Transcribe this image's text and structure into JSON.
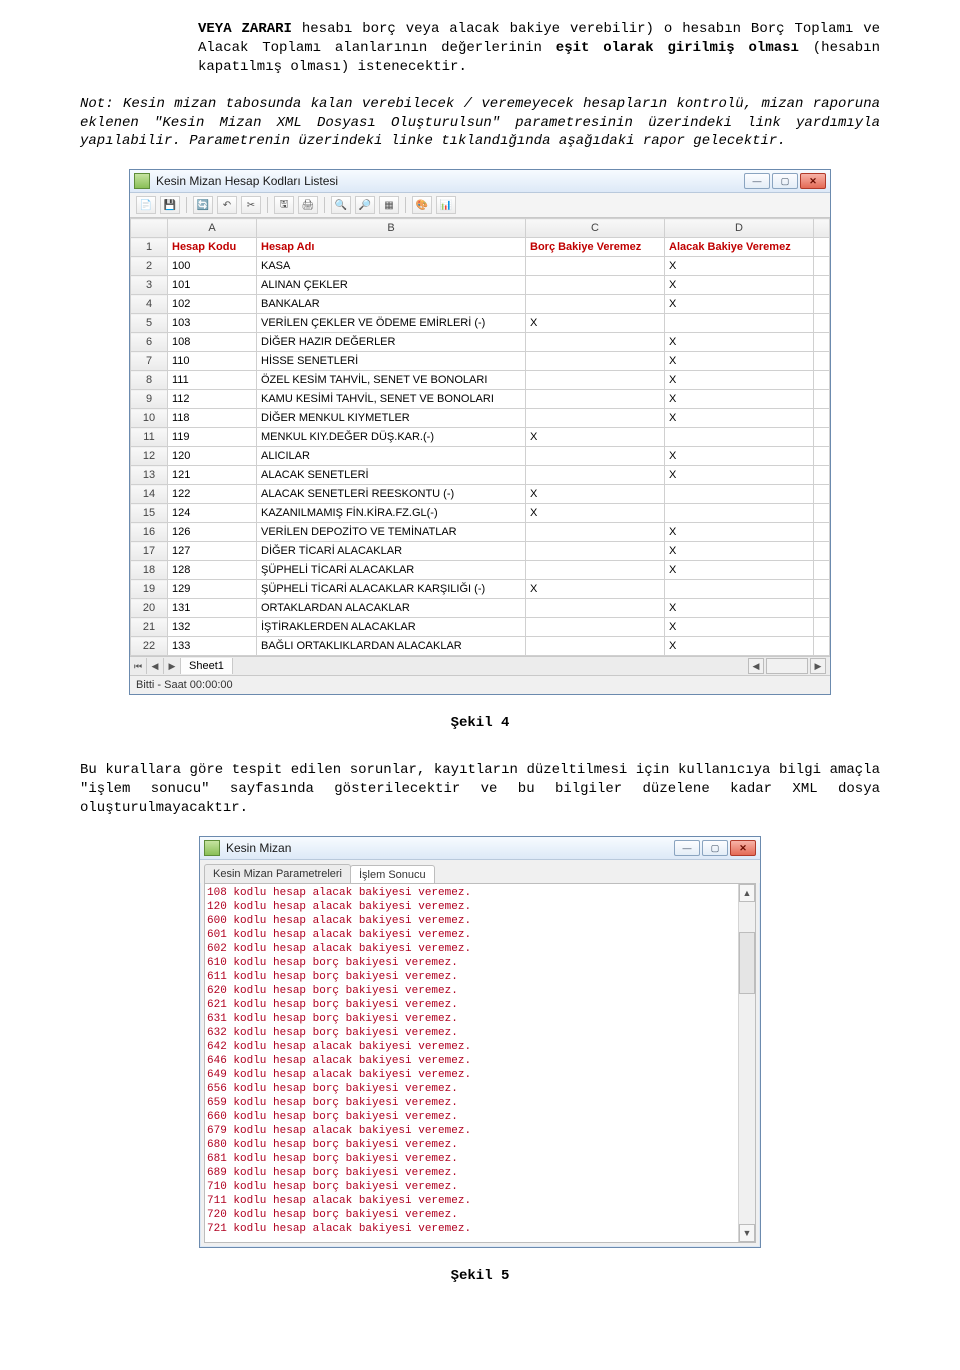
{
  "paragraphs": {
    "p1_prefix": "VEYA ZARARI",
    "p1_mid": " hesabı borç veya alacak bakiye verebilir) o hesabın Borç Toplamı ve Alacak Toplamı alanlarının değerlerinin ",
    "p1_bold2": "eşit olarak girilmiş olması",
    "p1_tail": " (hesabın kapatılmış olması) istenecektir.",
    "p2": "Not: Kesin mizan tabosunda kalan verebilecek / veremeyecek hesapların kontrolü, mizan raporuna eklenen \"Kesin Mizan XML Dosyası Oluşturulsun\" parametresinin üzerindeki link yardımıyla yapılabilir. Parametrenin üzerindeki linke tıklandığında aşağıdaki rapor gelecektir.",
    "sekil4": "Şekil 4",
    "p3": "Bu kurallara göre tespit edilen sorunlar, kayıtların düzeltilmesi için kullanıcıya bilgi amaçla \"işlem sonucu\" sayfasında gösterilecektir ve bu bilgiler düzelene kadar XML dosya oluşturulmayacaktır.",
    "sekil5": "Şekil 5"
  },
  "window1": {
    "title": "Kesin Mizan Hesap Kodları Listesi",
    "tool_icons": [
      "file-icon",
      "save-icon",
      "",
      "refresh-icon",
      "undo-icon",
      "cut-icon",
      "",
      "disk-icon",
      "print-icon",
      "",
      "zoom-in-icon",
      "zoom-out-icon",
      "grid-icon",
      "",
      "palette-icon",
      "chart-icon"
    ],
    "cols": [
      "",
      "A",
      "B",
      "C",
      "D",
      ""
    ],
    "headers": [
      "Hesap Kodu",
      "Hesap Adı",
      "Borç Bakiye Veremez",
      "Alacak Bakiye Veremez"
    ],
    "rows": [
      {
        "n": "1",
        "kod": "",
        "ad": "",
        "borc": "",
        "alacak": ""
      },
      {
        "n": "2",
        "kod": "100",
        "ad": "KASA",
        "borc": "",
        "alacak": "X"
      },
      {
        "n": "3",
        "kod": "101",
        "ad": "ALINAN ÇEKLER",
        "borc": "",
        "alacak": "X"
      },
      {
        "n": "4",
        "kod": "102",
        "ad": "BANKALAR",
        "borc": "",
        "alacak": "X"
      },
      {
        "n": "5",
        "kod": "103",
        "ad": "VERİLEN ÇEKLER VE ÖDEME EMİRLERİ (-)",
        "borc": "X",
        "alacak": ""
      },
      {
        "n": "6",
        "kod": "108",
        "ad": "DİĞER HAZIR DEĞERLER",
        "borc": "",
        "alacak": "X"
      },
      {
        "n": "7",
        "kod": "110",
        "ad": "HİSSE SENETLERİ",
        "borc": "",
        "alacak": "X"
      },
      {
        "n": "8",
        "kod": "111",
        "ad": "ÖZEL KESİM TAHVİL, SENET VE BONOLARI",
        "borc": "",
        "alacak": "X"
      },
      {
        "n": "9",
        "kod": "112",
        "ad": "KAMU KESİMİ TAHVİL, SENET VE BONOLARI",
        "borc": "",
        "alacak": "X"
      },
      {
        "n": "10",
        "kod": "118",
        "ad": "DİĞER MENKUL KIYMETLER",
        "borc": "",
        "alacak": "X"
      },
      {
        "n": "11",
        "kod": "119",
        "ad": "MENKUL KIY.DEĞER DÜŞ.KAR.(-)",
        "borc": "X",
        "alacak": ""
      },
      {
        "n": "12",
        "kod": "120",
        "ad": "ALICILAR",
        "borc": "",
        "alacak": "X"
      },
      {
        "n": "13",
        "kod": "121",
        "ad": "ALACAK SENETLERİ",
        "borc": "",
        "alacak": "X"
      },
      {
        "n": "14",
        "kod": "122",
        "ad": "ALACAK SENETLERİ REESKONTU (-)",
        "borc": "X",
        "alacak": ""
      },
      {
        "n": "15",
        "kod": "124",
        "ad": "KAZANILMAMIŞ FİN.KİRA.FZ.GL(-)",
        "borc": "X",
        "alacak": ""
      },
      {
        "n": "16",
        "kod": "126",
        "ad": "VERİLEN DEPOZİTO VE TEMİNATLAR",
        "borc": "",
        "alacak": "X"
      },
      {
        "n": "17",
        "kod": "127",
        "ad": "DİĞER TİCARİ ALACAKLAR",
        "borc": "",
        "alacak": "X"
      },
      {
        "n": "18",
        "kod": "128",
        "ad": "ŞÜPHELİ TİCARİ ALACAKLAR",
        "borc": "",
        "alacak": "X"
      },
      {
        "n": "19",
        "kod": "129",
        "ad": "ŞÜPHELİ TİCARİ ALACAKLAR KARŞILIĞI (-)",
        "borc": "X",
        "alacak": ""
      },
      {
        "n": "20",
        "kod": "131",
        "ad": "ORTAKLARDAN ALACAKLAR",
        "borc": "",
        "alacak": "X"
      },
      {
        "n": "21",
        "kod": "132",
        "ad": "İŞTİRAKLERDEN ALACAKLAR",
        "borc": "",
        "alacak": "X"
      },
      {
        "n": "22",
        "kod": "133",
        "ad": "BAĞLI ORTAKLIKLARDAN ALACAKLAR",
        "borc": "",
        "alacak": "X"
      }
    ],
    "sheet_tab": "Sheet1",
    "status": "Bitti - Saat 00:00:00"
  },
  "window2": {
    "title": "Kesin Mizan",
    "tabs": [
      "Kesin Mizan Parametreleri",
      "İşlem Sonucu"
    ],
    "active_tab": 1,
    "lines": [
      "108 kodlu hesap alacak bakiyesi veremez.",
      "120 kodlu hesap alacak bakiyesi veremez.",
      "600 kodlu hesap alacak bakiyesi veremez.",
      "601 kodlu hesap alacak bakiyesi veremez.",
      "602 kodlu hesap alacak bakiyesi veremez.",
      "610 kodlu hesap borç bakiyesi veremez.",
      "611 kodlu hesap borç bakiyesi veremez.",
      "620 kodlu hesap borç bakiyesi veremez.",
      "621 kodlu hesap borç bakiyesi veremez.",
      "631 kodlu hesap borç bakiyesi veremez.",
      "632 kodlu hesap borç bakiyesi veremez.",
      "642 kodlu hesap alacak bakiyesi veremez.",
      "646 kodlu hesap alacak bakiyesi veremez.",
      "649 kodlu hesap alacak bakiyesi veremez.",
      "656 kodlu hesap borç bakiyesi veremez.",
      "659 kodlu hesap borç bakiyesi veremez.",
      "660 kodlu hesap borç bakiyesi veremez.",
      "679 kodlu hesap alacak bakiyesi veremez.",
      "680 kodlu hesap borç bakiyesi veremez.",
      "681 kodlu hesap borç bakiyesi veremez.",
      "689 kodlu hesap borç bakiyesi veremez.",
      "710 kodlu hesap borç bakiyesi veremez.",
      "711 kodlu hesap alacak bakiyesi veremez.",
      "720 kodlu hesap borç bakiyesi veremez.",
      "721 kodlu hesap alacak bakiyesi veremez."
    ]
  }
}
